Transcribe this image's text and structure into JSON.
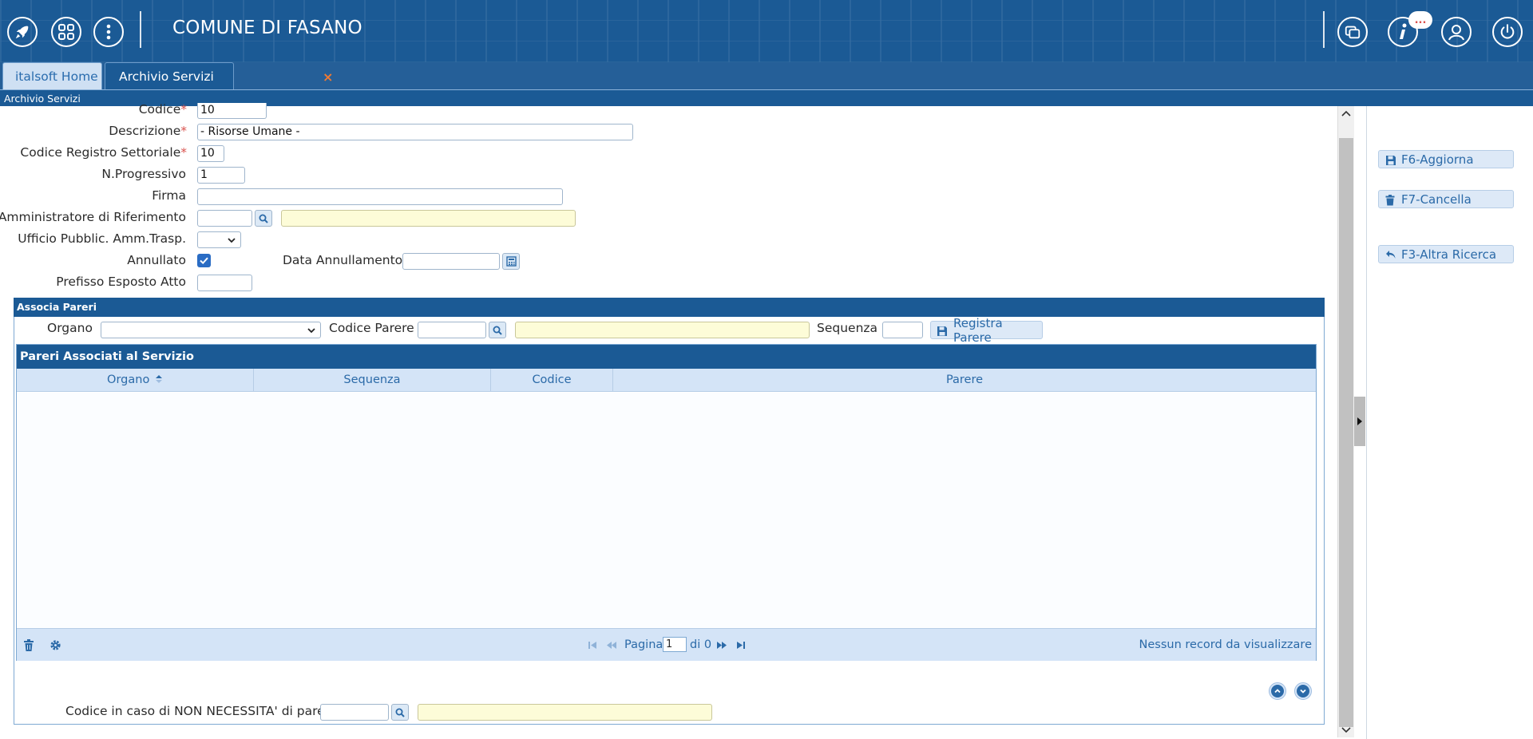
{
  "header": {
    "title": "COMUNE DI FASANO",
    "notification_badge": "..."
  },
  "tabs": [
    {
      "label": "italsoft Home"
    },
    {
      "label": "Archivio Servizi"
    }
  ],
  "tab_close_glyph": "×",
  "breadcrumb": "Archivio Servizi",
  "form": {
    "codice": {
      "label": "Codice",
      "value": "10"
    },
    "descrizione": {
      "label": "Descrizione",
      "value": "- Risorse Umane -"
    },
    "codice_registro": {
      "label": "Codice Registro Settoriale",
      "value": "10"
    },
    "progressivo": {
      "label": "N.Progressivo",
      "value": "1"
    },
    "firma": {
      "label": "Firma",
      "value": ""
    },
    "amministratore": {
      "label": "Amministratore di Riferimento",
      "value": "",
      "description": ""
    },
    "ufficio": {
      "label": "Ufficio Pubblic. Amm.Trasp.",
      "value": ""
    },
    "annullato": {
      "label": "Annullato",
      "checked": true
    },
    "data_annullamento": {
      "label": "Data Annullamento",
      "value": ""
    },
    "prefisso": {
      "label": "Prefisso Esposto Atto",
      "value": ""
    },
    "required_mark": "*"
  },
  "associa_pareri": {
    "legend": "Associa Pareri",
    "organo_label": "Organo",
    "organo_value": "",
    "codice_parere_label": "Codice Parere",
    "codice_parere_value": "",
    "parere_desc": "",
    "sequenza_label": "Sequenza",
    "sequenza_value": "",
    "registra_button": "Registra Parere"
  },
  "grid": {
    "caption": "Pareri Associati al Servizio",
    "columns": [
      "Organo",
      "Sequenza",
      "Codice",
      "Parere"
    ],
    "rows": [],
    "pager": {
      "page_label": "Pagina",
      "page_value": "1",
      "of_label": "di 0",
      "empty_message": "Nessun record da visualizzare"
    }
  },
  "non_necessita": {
    "label": "Codice in caso di NON NECESSITA' di parere",
    "value": "",
    "description": ""
  },
  "side_buttons": [
    {
      "label": "F6-Aggiorna",
      "icon": "save-icon"
    },
    {
      "label": "F7-Cancella",
      "icon": "trash-icon"
    },
    {
      "label": "F3-Altra Ricerca",
      "icon": "undo-icon"
    }
  ],
  "colors": {
    "header_bg": "#1b5a95",
    "accent": "#2b6aa8",
    "required": "#d9534f",
    "readonly_bg": "#fdfcd8"
  }
}
